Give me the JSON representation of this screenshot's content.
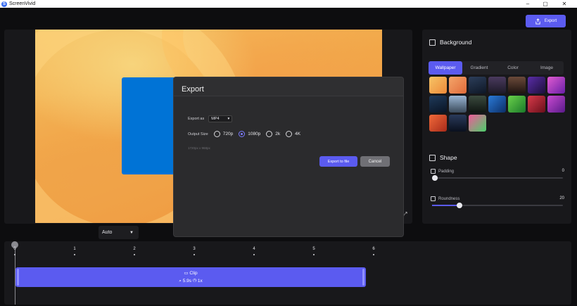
{
  "window": {
    "title": "ScreenVivid",
    "controls": [
      "–",
      "▢",
      "✕"
    ]
  },
  "toolbar": {
    "export_label": "Export"
  },
  "preview": {
    "zoom_label": "Auto"
  },
  "export_dialog": {
    "title": "Export",
    "export_as_label": "Export as",
    "format_value": "MP4",
    "output_size_label": "Output Size",
    "size_options": [
      "720p",
      "1080p",
      "2k",
      "4K"
    ],
    "selected_size": "1080p",
    "dimensions_text": "1720px x 968px",
    "export_button": "Export to file",
    "cancel_button": "Cancel"
  },
  "sidebar": {
    "background_title": "Background",
    "tabs": [
      "Wallpaper",
      "Gradient",
      "Color",
      "Image"
    ],
    "active_tab": "Wallpaper",
    "shape_title": "Shape",
    "padding_label": "Padding",
    "padding_value": "0",
    "roundness_label": "Roundness",
    "roundness_value": "20"
  },
  "timeline": {
    "ticks": [
      "0",
      "1",
      "2",
      "3",
      "4",
      "5",
      "6"
    ],
    "clip_label": "Clip",
    "clip_info": "5.9s",
    "clip_speed": "1x"
  },
  "colors": {
    "accent": "#5b5bf0",
    "canvas_blue": "#0073d6"
  }
}
